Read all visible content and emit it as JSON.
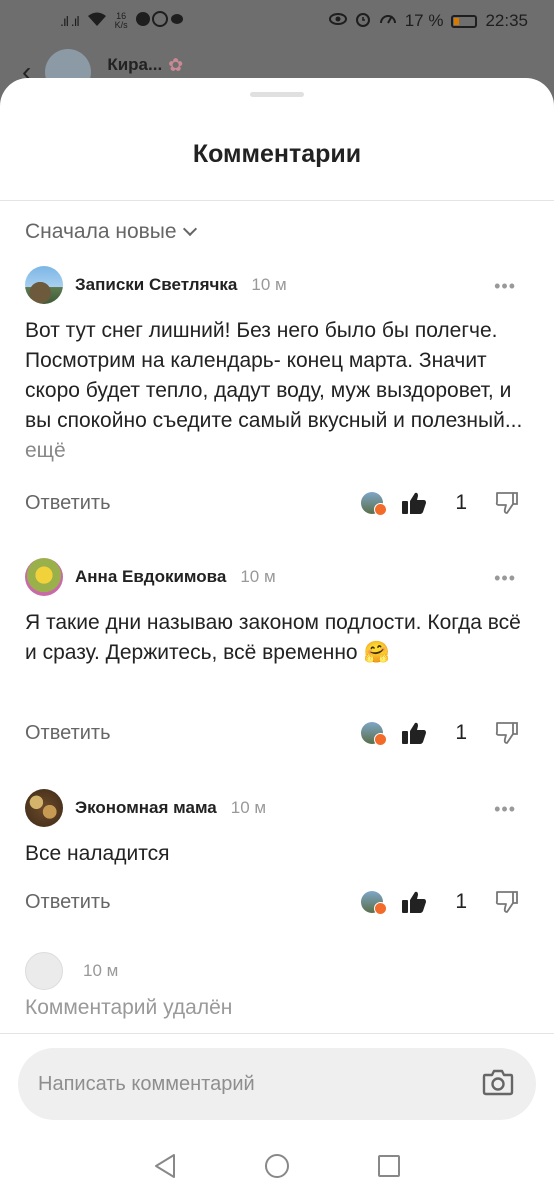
{
  "status_bar": {
    "signal": ".ıl .ıl",
    "speed_value": "16",
    "speed_unit": "K/s",
    "battery": "17 %",
    "time": "22:35"
  },
  "background_header": {
    "name": "Кира..."
  },
  "sheet": {
    "title": "Комментарии",
    "sort_label": "Сначала новые"
  },
  "comments": [
    {
      "author": "Записки Светлячка",
      "time": "10 м",
      "text": "Вот тут снег лишний! Без него было бы полегче. Посмотрим на календарь- конец марта. Значит скоро будет тепло, дадут воду, муж выздоровет, и вы спокойно съедите самый вкусный и полезный...",
      "more_label": "ещё",
      "reply_label": "Ответить",
      "likes": "1"
    },
    {
      "author": "Анна Евдокимова",
      "time": "10 м",
      "text": "Я такие дни называю законом подлости. Когда всё и сразу. Держитесь, всё временно",
      "emoji": "🤗",
      "reply_label": "Ответить",
      "likes": "1"
    },
    {
      "author": "Экономная мама",
      "time": "10 м",
      "text": "Все наладится",
      "reply_label": "Ответить",
      "likes": "1"
    },
    {
      "author": "",
      "time": "10 м",
      "text": "Комментарий удалён"
    }
  ],
  "input": {
    "placeholder": "Написать комментарий"
  },
  "colors": {
    "reaction_accent": "#f26b2a",
    "sheet_background": "#ffffff",
    "input_background": "#efefef"
  },
  "icons": [
    "more-dots-icon",
    "thumbs-up-icon",
    "thumbs-down-icon",
    "camera-icon",
    "chevron-down-icon",
    "back-triangle-icon",
    "home-circle-icon",
    "recents-square-icon"
  ]
}
